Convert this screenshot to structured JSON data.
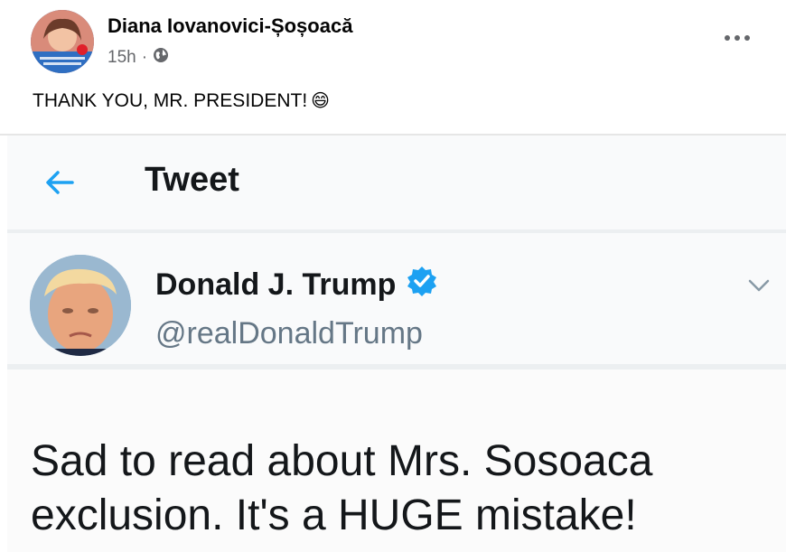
{
  "post": {
    "author": "Diana Iovanovici-Șoșoacă",
    "time": "15h",
    "separator": "·",
    "text": "THANK YOU, MR. PRESIDENT!",
    "emoji": "😄",
    "privacy_icon": "globe-icon",
    "more_icon": "more-options-icon"
  },
  "tweet": {
    "header_title": "Tweet",
    "back_icon": "arrow-left-icon",
    "author_name": "Donald J. Trump",
    "verified_icon": "verified-badge-icon",
    "handle": "@realDonaldTrump",
    "caret_icon": "chevron-down-icon",
    "text_line1": "Sad to read about Mrs. Sosoaca",
    "text_line2": "exclusion. It's a HUGE mistake!"
  },
  "colors": {
    "twitter_blue": "#1da1f2",
    "fb_text": "#050505",
    "fb_secondary": "#65676b",
    "tw_text": "#14171a",
    "tw_secondary": "#657786"
  }
}
